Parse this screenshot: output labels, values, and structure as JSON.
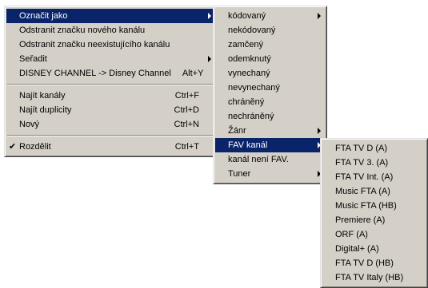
{
  "menu1": {
    "items": [
      {
        "label": "Označit jako",
        "shortcut": "",
        "submenu": true,
        "selected": true,
        "checked": false
      },
      {
        "label": "Odstranit značku nového kanálu",
        "shortcut": "",
        "submenu": false,
        "selected": false,
        "checked": false
      },
      {
        "label": "Odstranit značku neexistujícího kanálu",
        "shortcut": "",
        "submenu": false,
        "selected": false,
        "checked": false
      },
      {
        "label": "Seřadit",
        "shortcut": "",
        "submenu": true,
        "selected": false,
        "checked": false
      },
      {
        "label": "DISNEY CHANNEL -> Disney Channel",
        "shortcut": "Alt+Y",
        "submenu": false,
        "selected": false,
        "checked": false
      },
      {
        "separator": true
      },
      {
        "label": "Najít kanály",
        "shortcut": "Ctrl+F",
        "submenu": false,
        "selected": false,
        "checked": false
      },
      {
        "label": "Najít duplicity",
        "shortcut": "Ctrl+D",
        "submenu": false,
        "selected": false,
        "checked": false
      },
      {
        "label": "Nový",
        "shortcut": "Ctrl+N",
        "submenu": false,
        "selected": false,
        "checked": false
      },
      {
        "separator": true
      },
      {
        "label": "Rozdělit",
        "shortcut": "Ctrl+T",
        "submenu": false,
        "selected": false,
        "checked": true
      }
    ]
  },
  "menu2": {
    "items": [
      {
        "label": "kódovaný",
        "submenu": true,
        "selected": false
      },
      {
        "label": "nekódovaný",
        "submenu": false,
        "selected": false
      },
      {
        "label": "zamčený",
        "submenu": false,
        "selected": false
      },
      {
        "label": "odemknutý",
        "submenu": false,
        "selected": false
      },
      {
        "label": "vynechaný",
        "submenu": false,
        "selected": false
      },
      {
        "label": "nevynechaný",
        "submenu": false,
        "selected": false
      },
      {
        "label": "chráněný",
        "submenu": false,
        "selected": false
      },
      {
        "label": "nechráněný",
        "submenu": false,
        "selected": false
      },
      {
        "label": "Žánr",
        "submenu": true,
        "selected": false
      },
      {
        "label": "FAV kanál",
        "submenu": true,
        "selected": true
      },
      {
        "label": "kanál není FAV.",
        "submenu": false,
        "selected": false
      },
      {
        "label": "Tuner",
        "submenu": true,
        "selected": false
      }
    ]
  },
  "menu3": {
    "items": [
      {
        "label": "FTA TV D (A)"
      },
      {
        "label": "FTA TV 3. (A)"
      },
      {
        "label": "FTA TV Int. (A)"
      },
      {
        "label": "Music FTA (A)"
      },
      {
        "label": "Music FTA (HB)"
      },
      {
        "label": "Premiere (A)"
      },
      {
        "label": "ORF (A)"
      },
      {
        "label": "Digital+ (A)"
      },
      {
        "label": "FTA TV D (HB)"
      },
      {
        "label": "FTA TV Italy (HB)"
      }
    ]
  },
  "icons": {
    "check": "✔"
  },
  "colors": {
    "menu_bg": "#d4d0c8",
    "highlight": "#0a246a",
    "highlight_text": "#ffffff"
  }
}
